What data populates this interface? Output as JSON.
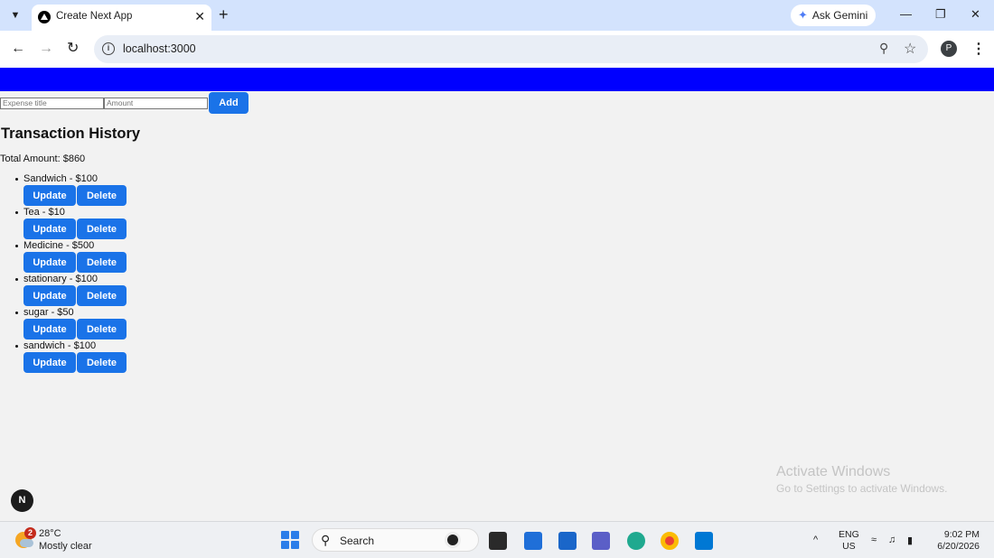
{
  "browser": {
    "tab_title": "Create Next App",
    "gemini_label": "Ask Gemini",
    "url": "localhost:3000",
    "profile_initial": "P"
  },
  "page": {
    "form": {
      "title_placeholder": "Expense title",
      "amount_placeholder": "Amount",
      "add_label": "Add"
    },
    "heading": "Transaction History",
    "total": "Total Amount: $860",
    "transactions": [
      {
        "label": "Sandwich - $100"
      },
      {
        "label": "Tea - $10"
      },
      {
        "label": "Medicine - $500"
      },
      {
        "label": "stationary - $100"
      },
      {
        "label": "sugar - $50"
      },
      {
        "label": "sandwich - $100"
      }
    ],
    "update_label": "Update",
    "delete_label": "Delete",
    "header_bar_color": "#0000ff",
    "button_color": "#1a73e8",
    "dev_badge": "N"
  },
  "watermark": {
    "title": "Activate Windows",
    "subtitle": "Go to Settings to activate Windows."
  },
  "taskbar": {
    "weather_badge": "2",
    "temperature": "28°C",
    "condition": "Mostly clear",
    "search_label": "Search",
    "lang_line1": "ENG",
    "lang_line2": "US",
    "time": "9:02 PM",
    "date": "6/20/2026"
  }
}
